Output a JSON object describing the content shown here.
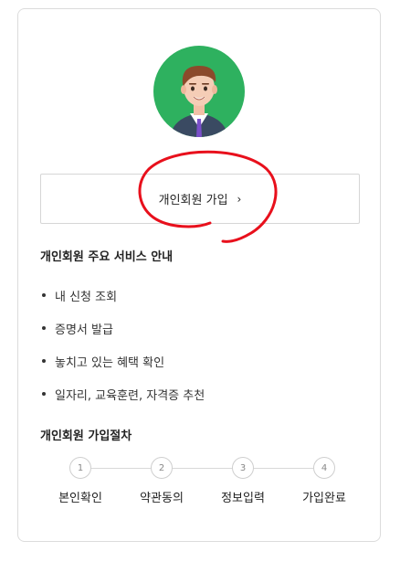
{
  "join_button": {
    "label": "개인회원 가입",
    "chevron": "›"
  },
  "services": {
    "title": "개인회원 주요 서비스 안내",
    "items": [
      {
        "label": "내 신청 조회"
      },
      {
        "label": "증명서 발급"
      },
      {
        "label": "놓치고 있는 혜택 확인"
      },
      {
        "label": "일자리, 교육훈련, 자격증 추천"
      }
    ]
  },
  "procedure": {
    "title": "개인회원 가입절차",
    "steps": [
      {
        "number": "1",
        "label": "본인확인"
      },
      {
        "number": "2",
        "label": "약관동의"
      },
      {
        "number": "3",
        "label": "정보입력"
      },
      {
        "number": "4",
        "label": "가입완료"
      }
    ]
  },
  "colors": {
    "avatar_bg": "#2eb15f",
    "annotation": "#e8101c",
    "border": "#dcdcdc"
  }
}
